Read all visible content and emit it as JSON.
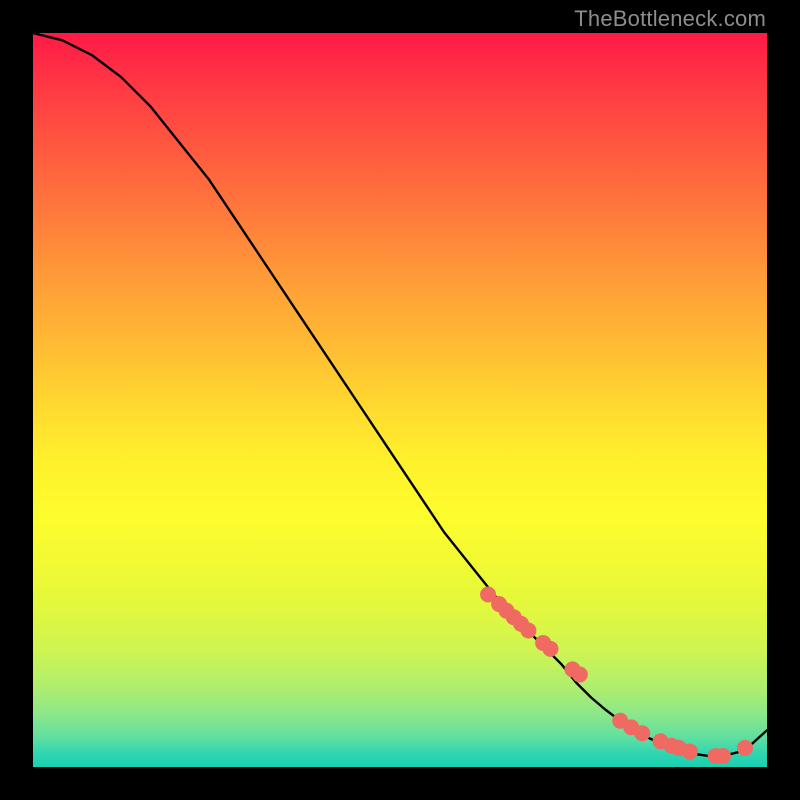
{
  "watermark": "TheBottleneck.com",
  "chart_data": {
    "type": "line",
    "title": "",
    "xlabel": "",
    "ylabel": "",
    "xlim": [
      0,
      100
    ],
    "ylim": [
      0,
      100
    ],
    "grid": false,
    "legend": false,
    "series": [
      {
        "name": "bottleneck-curve",
        "x": [
          0,
          4,
          8,
          12,
          16,
          20,
          24,
          28,
          32,
          36,
          40,
          44,
          48,
          52,
          56,
          60,
          64,
          68,
          72,
          74,
          76,
          78,
          80,
          82,
          84,
          86,
          88,
          90,
          92,
          94,
          96,
          98,
          100
        ],
        "y": [
          100,
          99,
          97,
          94,
          90,
          85,
          80,
          74,
          68,
          62,
          56,
          50,
          44,
          38,
          32,
          27,
          22,
          18,
          14,
          11.5,
          9.5,
          7.8,
          6.3,
          5.0,
          3.9,
          3.0,
          2.3,
          1.8,
          1.5,
          1.5,
          2.0,
          3.2,
          5.0
        ]
      }
    ],
    "markers": {
      "name": "highlight-dots",
      "color": "#ef6a63",
      "radius_px": 8,
      "x": [
        62,
        63.5,
        64.5,
        65.5,
        66.5,
        67.5,
        69.5,
        70.5,
        73.5,
        74.5,
        80,
        81.5,
        83,
        85.5,
        87,
        88,
        89.5,
        93,
        94,
        97
      ],
      "y": [
        23.5,
        22.2,
        21.3,
        20.4,
        19.5,
        18.6,
        16.9,
        16.1,
        13.3,
        12.6,
        6.3,
        5.4,
        4.6,
        3.5,
        2.9,
        2.6,
        2.1,
        1.5,
        1.5,
        2.6
      ]
    }
  }
}
